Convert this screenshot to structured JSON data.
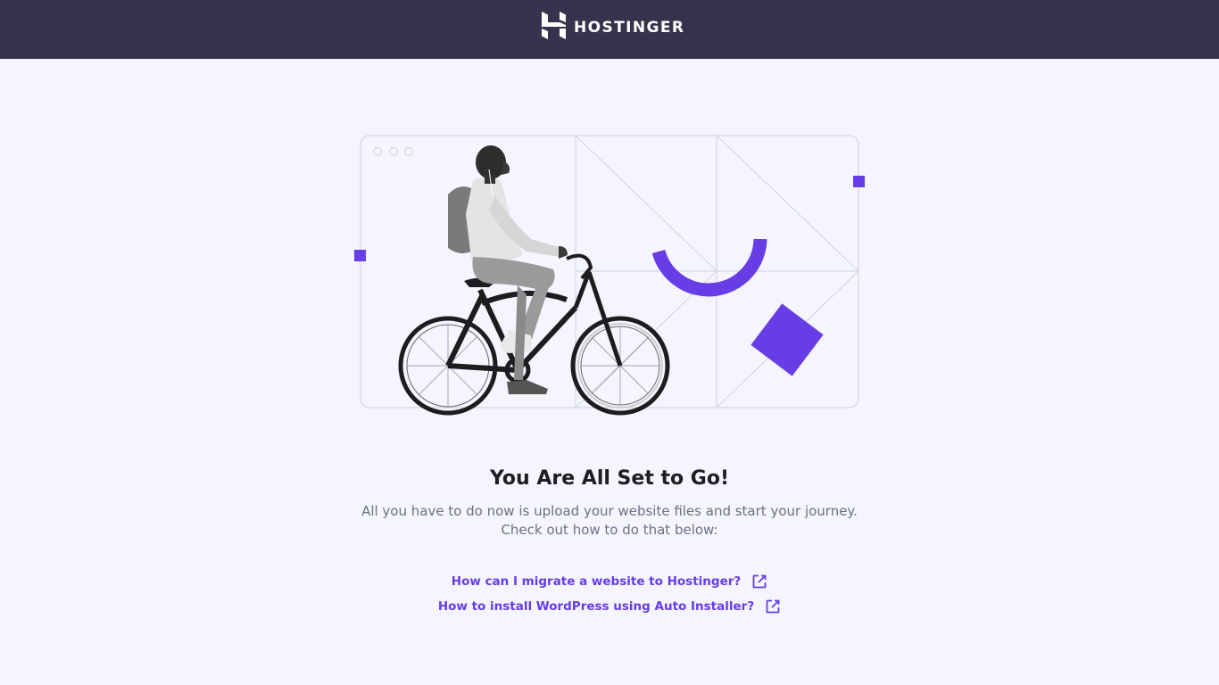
{
  "header": {
    "brand_name": "HOSTINGER",
    "logo_icon": "hostinger-h-logo"
  },
  "hero": {
    "illustration": "person-riding-bicycle",
    "accent_color": "#673de6"
  },
  "main": {
    "title": "You Are All Set to Go!",
    "subtitle_line1": "All you have to do now is upload your website files and start your journey.",
    "subtitle_line2": "Check out how to do that below:"
  },
  "links": [
    {
      "label": "How can I migrate a website to Hostinger?",
      "icon": "external-link-icon"
    },
    {
      "label": "How to install WordPress using Auto Installer?",
      "icon": "external-link-icon"
    }
  ],
  "colors": {
    "header_bg": "#36344d",
    "page_bg": "#f4f5ff",
    "link": "#673de6",
    "title": "#1d1e20",
    "subtitle": "#6d7081"
  }
}
